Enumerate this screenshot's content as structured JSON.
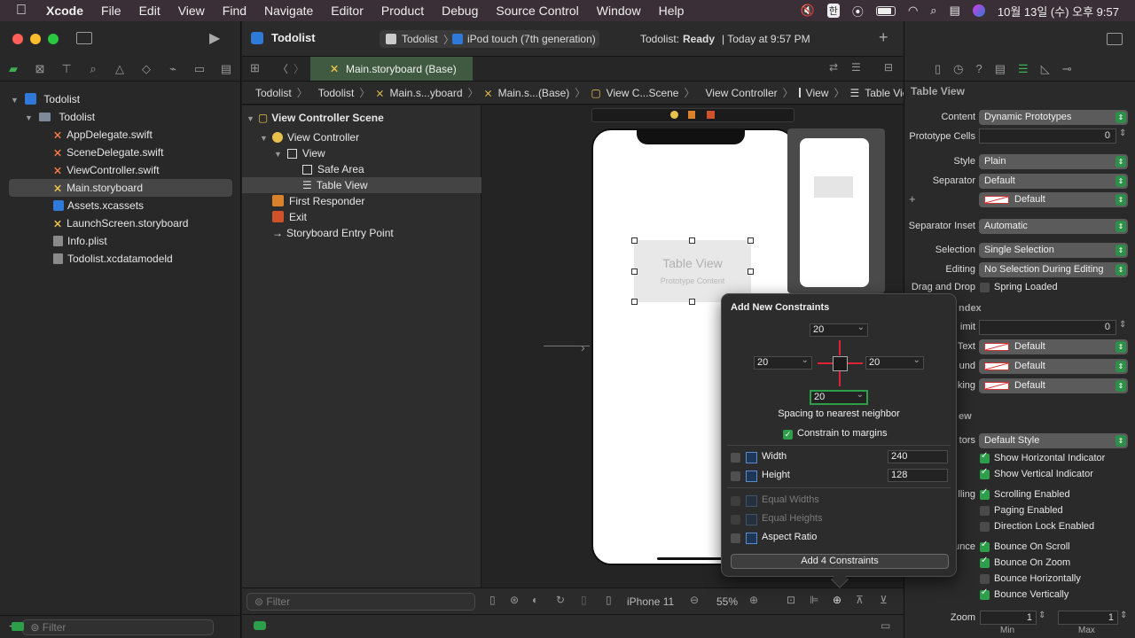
{
  "menubar": {
    "app": "Xcode",
    "items": [
      "File",
      "Edit",
      "View",
      "Find",
      "Navigate",
      "Editor",
      "Product",
      "Debug",
      "Source Control",
      "Window",
      "Help"
    ],
    "clock": "10월 13일 (수) 오후 9:57"
  },
  "navigator": {
    "project": "Todolist",
    "group": "Todolist",
    "files": [
      "AppDelegate.swift",
      "SceneDelegate.swift",
      "ViewController.swift",
      "Main.storyboard",
      "Assets.xcassets",
      "LaunchScreen.storyboard",
      "Info.plist",
      "Todolist.xcdatamodeld"
    ],
    "selected": "Main.storyboard",
    "filter_placeholder": "Filter"
  },
  "toolbar": {
    "title": "Todolist",
    "scheme": "Todolist",
    "device": "iPod touch (7th generation)",
    "status_project": "Todolist:",
    "status_state": "Ready",
    "status_time": "| Today at 9:57 PM"
  },
  "editor": {
    "tab": "Main.storyboard (Base)",
    "jumpbar": [
      "Todolist",
      "Todolist",
      "Main.s...yboard",
      "Main.s...(Base)",
      "View C...Scene",
      "View Controller",
      "View",
      "Table View"
    ]
  },
  "outline": {
    "scene": "View Controller Scene",
    "vc": "View Controller",
    "view": "View",
    "safe_area": "Safe Area",
    "table_view": "Table View",
    "first_responder": "First Responder",
    "exit": "Exit",
    "entry": "Storyboard Entry Point",
    "filter_placeholder": "Filter"
  },
  "canvas": {
    "table_title": "Table View",
    "table_sub": "Prototype Content",
    "device_label": "iPhone 11",
    "zoom": "55%"
  },
  "popover": {
    "title": "Add New Constraints",
    "top": "20",
    "left": "20",
    "right": "20",
    "bottom": "20",
    "spacing_label": "Spacing to nearest neighbor",
    "margins_label": "Constrain to margins",
    "width_label": "Width",
    "width_value": "240",
    "height_label": "Height",
    "height_value": "128",
    "equal_widths": "Equal Widths",
    "equal_heights": "Equal Heights",
    "aspect_ratio": "Aspect Ratio",
    "button": "Add 4 Constraints"
  },
  "inspector": {
    "section": "Table View",
    "content_label": "Content",
    "content_value": "Dynamic Prototypes",
    "proto_label": "Prototype Cells",
    "proto_value": "0",
    "style_label": "Style",
    "style_value": "Plain",
    "separator_label": "Separator",
    "separator_value": "Default",
    "separator_color": "Default",
    "inset_label": "Separator Inset",
    "inset_value": "Automatic",
    "selection_label": "Selection",
    "selection_value": "Single Selection",
    "editing_label": "Editing",
    "editing_value": "No Selection During Editing",
    "drag_label": "Drag and Drop",
    "drag_value": "Spring Loaded",
    "index_section": "ndex",
    "limit_label": "imit",
    "limit_value": "0",
    "text_label": "Text",
    "text_value": "Default",
    "bg_label": "und",
    "bg_value": "Default",
    "tracking_label": "king",
    "tracking_value": "Default",
    "scroll_section": "ew",
    "indicators_label": "tors",
    "indicators_value": "Default Style",
    "show_h": "Show Horizontal Indicator",
    "show_v": "Show Vertical Indicator",
    "scrolling_label": "lling",
    "scroll_enabled": "Scrolling Enabled",
    "paging": "Paging Enabled",
    "direction_lock": "Direction Lock Enabled",
    "bounce_label": "unce",
    "bounce_scroll": "Bounce On Scroll",
    "bounce_zoom": "Bounce On Zoom",
    "bounce_h": "Bounce Horizontally",
    "bounce_v": "Bounce Vertically",
    "zoom_label": "Zoom",
    "zoom_min": "1",
    "zoom_max": "1",
    "min_label": "Min",
    "max_label": "Max"
  },
  "colors": {
    "accent": "#2d9e4a",
    "selection": "#464646",
    "xcode_blue": "#2f7ad8"
  }
}
